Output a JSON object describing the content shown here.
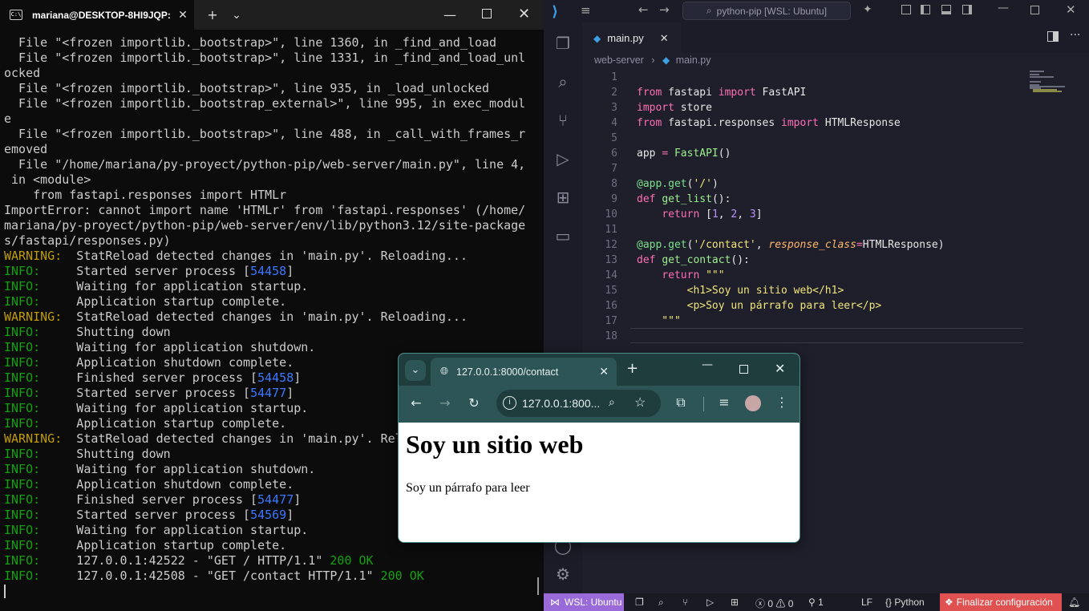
{
  "terminal": {
    "tab_title": "mariana@DESKTOP-8HI9JQP:",
    "close_glyph": "✕",
    "new_tab_glyph": "+",
    "dropdown_glyph": "⌄",
    "lines": [
      {
        "text": "  File \"<frozen importlib._bootstrap>\", line 1360, in _find_and_load"
      },
      {
        "text": "  File \"<frozen importlib._bootstrap>\", line 1331, in _find_and_load_unl"
      },
      {
        "text": "ocked"
      },
      {
        "text": "  File \"<frozen importlib._bootstrap>\", line 935, in _load_unlocked"
      },
      {
        "text": "  File \"<frozen importlib._bootstrap_external>\", line 995, in exec_modul"
      },
      {
        "text": "e"
      },
      {
        "text": "  File \"<frozen importlib._bootstrap>\", line 488, in _call_with_frames_r"
      },
      {
        "text": "emoved"
      },
      {
        "text": "  File \"/home/mariana/py-proyect/python-pip/web-server/main.py\", line 4,"
      },
      {
        "text": " in <module>"
      },
      {
        "text": "    from fastapi.responses import HTMLr"
      },
      {
        "text": "ImportError: cannot import name 'HTMLr' from 'fastapi.responses' (/home/"
      },
      {
        "text": "mariana/py-proyect/python-pip/web-server/env/lib/python3.12/site-package"
      },
      {
        "text": "s/fastapi/responses.py)"
      },
      {
        "level": "WARNING:",
        "text": "  StatReload detected changes in 'main.py'. Reloading..."
      },
      {
        "level": "INFO:",
        "text": "     Started server process [",
        "num": "54458",
        "tail": "]"
      },
      {
        "level": "INFO:",
        "text": "     Waiting for application startup."
      },
      {
        "level": "INFO:",
        "text": "     Application startup complete."
      },
      {
        "level": "WARNING:",
        "text": "  StatReload detected changes in 'main.py'. Reloading..."
      },
      {
        "level": "INFO:",
        "text": "     Shutting down"
      },
      {
        "level": "INFO:",
        "text": "     Waiting for application shutdown."
      },
      {
        "level": "INFO:",
        "text": "     Application shutdown complete."
      },
      {
        "level": "INFO:",
        "text": "     Finished server process [",
        "num": "54458",
        "tail": "]"
      },
      {
        "level": "INFO:",
        "text": "     Started server process [",
        "num": "54477",
        "tail": "]"
      },
      {
        "level": "INFO:",
        "text": "     Waiting for application startup."
      },
      {
        "level": "INFO:",
        "text": "     Application startup complete."
      },
      {
        "level": "WARNING:",
        "text": "  StatReload detected changes in 'main.py'. Rel"
      },
      {
        "level": "INFO:",
        "text": "     Shutting down"
      },
      {
        "level": "INFO:",
        "text": "     Waiting for application shutdown."
      },
      {
        "level": "INFO:",
        "text": "     Application shutdown complete."
      },
      {
        "level": "INFO:",
        "text": "     Finished server process [",
        "num": "54477",
        "tail": "]"
      },
      {
        "level": "INFO:",
        "text": "     Started server process [",
        "num": "54569",
        "tail": "]"
      },
      {
        "level": "INFO:",
        "text": "     Waiting for application startup."
      },
      {
        "level": "INFO:",
        "text": "     Application startup complete."
      },
      {
        "level": "INFO:",
        "text": "     127.0.0.1:42522 - \"GET / HTTP/1.1\" ",
        "ok": "200 OK"
      },
      {
        "level": "INFO:",
        "text": "     127.0.0.1:42508 - \"GET /contact HTTP/1.1\" ",
        "ok": "200 OK"
      }
    ]
  },
  "vscode": {
    "search_placeholder": "python-pip [WSL: Ubuntu]",
    "tab_label": "main.py",
    "breadcrumb_folder": "web-server",
    "breadcrumb_sep": "›",
    "breadcrumb_file": "main.py",
    "line_numbers": [
      "1",
      "2",
      "3",
      "4",
      "5",
      "6",
      "7",
      "8",
      "9",
      "10",
      "11",
      "12",
      "13",
      "14",
      "15",
      "16",
      "17",
      "18"
    ],
    "code_lines": [
      [],
      [
        {
          "t": "from",
          "c": "k"
        },
        {
          "t": " fastapi "
        },
        {
          "t": "import",
          "c": "k"
        },
        {
          "t": " FastAPI"
        }
      ],
      [
        {
          "t": "import",
          "c": "k"
        },
        {
          "t": " store"
        }
      ],
      [
        {
          "t": "from",
          "c": "k"
        },
        {
          "t": " fastapi.responses "
        },
        {
          "t": "import",
          "c": "k"
        },
        {
          "t": " HTMLResponse"
        }
      ],
      [],
      [
        {
          "t": "app "
        },
        {
          "t": "=",
          "c": "k"
        },
        {
          "t": " "
        },
        {
          "t": "FastAPI",
          "c": "f"
        },
        {
          "t": "()"
        }
      ],
      [],
      [
        {
          "t": "@app.get",
          "c": "d"
        },
        {
          "t": "("
        },
        {
          "t": "'/'",
          "c": "s"
        },
        {
          "t": ")"
        }
      ],
      [
        {
          "t": "def",
          "c": "k"
        },
        {
          "t": " "
        },
        {
          "t": "get_list",
          "c": "f"
        },
        {
          "t": "():"
        }
      ],
      [
        {
          "t": "    "
        },
        {
          "t": "return",
          "c": "k"
        },
        {
          "t": " ["
        },
        {
          "t": "1",
          "c": "num"
        },
        {
          "t": ", "
        },
        {
          "t": "2",
          "c": "num"
        },
        {
          "t": ", "
        },
        {
          "t": "3",
          "c": "num"
        },
        {
          "t": "]"
        }
      ],
      [],
      [
        {
          "t": "@app.get",
          "c": "d"
        },
        {
          "t": "("
        },
        {
          "t": "'/contact'",
          "c": "s"
        },
        {
          "t": ", "
        },
        {
          "t": "response_class",
          "c": "p"
        },
        {
          "t": "=",
          "c": "k"
        },
        {
          "t": "HTMLResponse)"
        }
      ],
      [
        {
          "t": "def",
          "c": "k"
        },
        {
          "t": " "
        },
        {
          "t": "get_contact",
          "c": "f"
        },
        {
          "t": "():"
        }
      ],
      [
        {
          "t": "    "
        },
        {
          "t": "return",
          "c": "k"
        },
        {
          "t": " "
        },
        {
          "t": "\"\"\"",
          "c": "s"
        }
      ],
      [
        {
          "t": "        <h1>Soy un sitio web</h1>",
          "c": "s"
        }
      ],
      [
        {
          "t": "        <p>Soy un párrafo para leer</p>",
          "c": "s"
        }
      ],
      [
        {
          "t": "    \"\"\"",
          "c": "s"
        }
      ],
      []
    ],
    "status": {
      "remote": "WSL: Ubuntu",
      "errors": "0",
      "warnings": "0",
      "ports": "1",
      "eol": "LF",
      "language": "Python",
      "finalizar": "Finalizar configuración"
    }
  },
  "browser": {
    "tab_title": "127.0.0.1:8000/contact",
    "address": "127.0.0.1:800...",
    "page_heading": "Soy un sitio web",
    "page_paragraph": "Soy un párrafo para leer"
  }
}
